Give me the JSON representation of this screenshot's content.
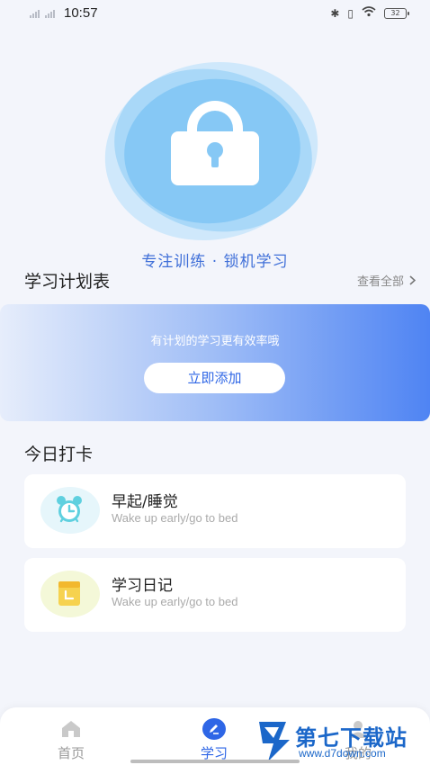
{
  "status_bar": {
    "time": "10:57",
    "battery": "32"
  },
  "hero": {
    "slogan": "专注训练 · 锁机学习"
  },
  "plan": {
    "title": "学习计划表",
    "view_all": "查看全部",
    "banner_text": "有计划的学习更有效率哦",
    "add_button": "立即添加"
  },
  "checkin": {
    "title": "今日打卡",
    "items": [
      {
        "title": "早起/睡觉",
        "subtitle": "Wake up early/go to bed",
        "icon": "alarm-clock-icon"
      },
      {
        "title": "学习日记",
        "subtitle": "Wake up early/go to bed",
        "icon": "notebook-icon"
      }
    ]
  },
  "nav": {
    "items": [
      {
        "label": "首页",
        "icon": "home-icon"
      },
      {
        "label": "学习",
        "icon": "pencil-icon"
      },
      {
        "label": "我的",
        "icon": "profile-icon"
      }
    ],
    "active_color": "#2e66e6"
  },
  "watermark": {
    "brand": "第七下载站",
    "url": "www.d7down.com"
  },
  "colors": {
    "accent": "#2e66e6",
    "hero_blue": "#86c8f5",
    "background": "#f3f5fb"
  }
}
